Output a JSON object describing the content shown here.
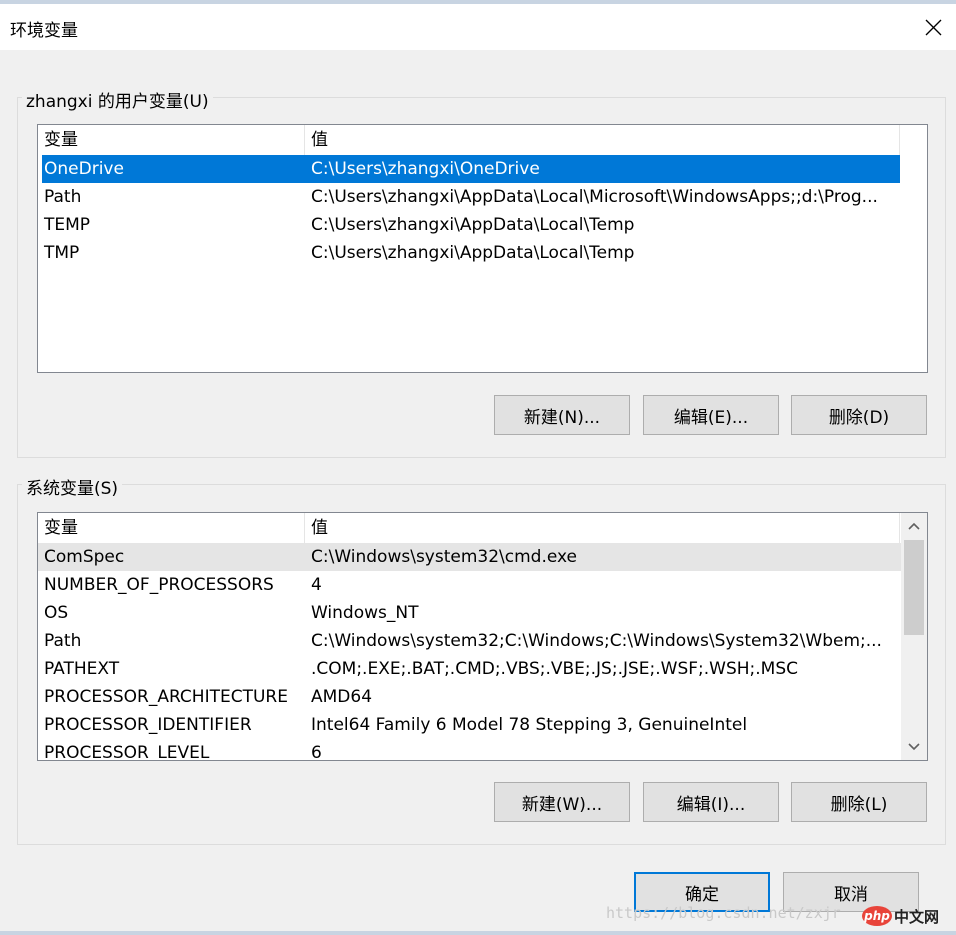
{
  "window": {
    "title": "环境变量"
  },
  "user_group": {
    "label": "zhangxi 的用户变量(U)",
    "columns": [
      "变量",
      "值"
    ],
    "rows": [
      {
        "name": "OneDrive",
        "value": "C:\\Users\\zhangxi\\OneDrive"
      },
      {
        "name": "Path",
        "value": "C:\\Users\\zhangxi\\AppData\\Local\\Microsoft\\WindowsApps;;d:\\Prog..."
      },
      {
        "name": "TEMP",
        "value": "C:\\Users\\zhangxi\\AppData\\Local\\Temp"
      },
      {
        "name": "TMP",
        "value": "C:\\Users\\zhangxi\\AppData\\Local\\Temp"
      }
    ],
    "buttons": {
      "new": "新建(N)...",
      "edit": "编辑(E)...",
      "delete": "删除(D)"
    }
  },
  "system_group": {
    "label": "系统变量(S)",
    "columns": [
      "变量",
      "值"
    ],
    "rows": [
      {
        "name": "ComSpec",
        "value": "C:\\Windows\\system32\\cmd.exe"
      },
      {
        "name": "NUMBER_OF_PROCESSORS",
        "value": "4"
      },
      {
        "name": "OS",
        "value": "Windows_NT"
      },
      {
        "name": "Path",
        "value": "C:\\Windows\\system32;C:\\Windows;C:\\Windows\\System32\\Wbem;..."
      },
      {
        "name": "PATHEXT",
        "value": ".COM;.EXE;.BAT;.CMD;.VBS;.VBE;.JS;.JSE;.WSF;.WSH;.MSC"
      },
      {
        "name": "PROCESSOR_ARCHITECTURE",
        "value": "AMD64"
      },
      {
        "name": "PROCESSOR_IDENTIFIER",
        "value": "Intel64 Family 6 Model 78 Stepping 3, GenuineIntel"
      },
      {
        "name": "PROCESSOR_LEVEL",
        "value": "6"
      }
    ],
    "buttons": {
      "new": "新建(W)...",
      "edit": "编辑(I)...",
      "delete": "删除(L)"
    }
  },
  "footer": {
    "ok": "确定",
    "cancel": "取消"
  },
  "watermark": {
    "url": "https://blog.csdn.net/zxjr",
    "logo_badge": "php",
    "logo_text": "中文网"
  },
  "colors": {
    "selection": "#0078d7",
    "focus_row": "#e5e5e5",
    "dialog_bg": "#f0f0f0"
  }
}
